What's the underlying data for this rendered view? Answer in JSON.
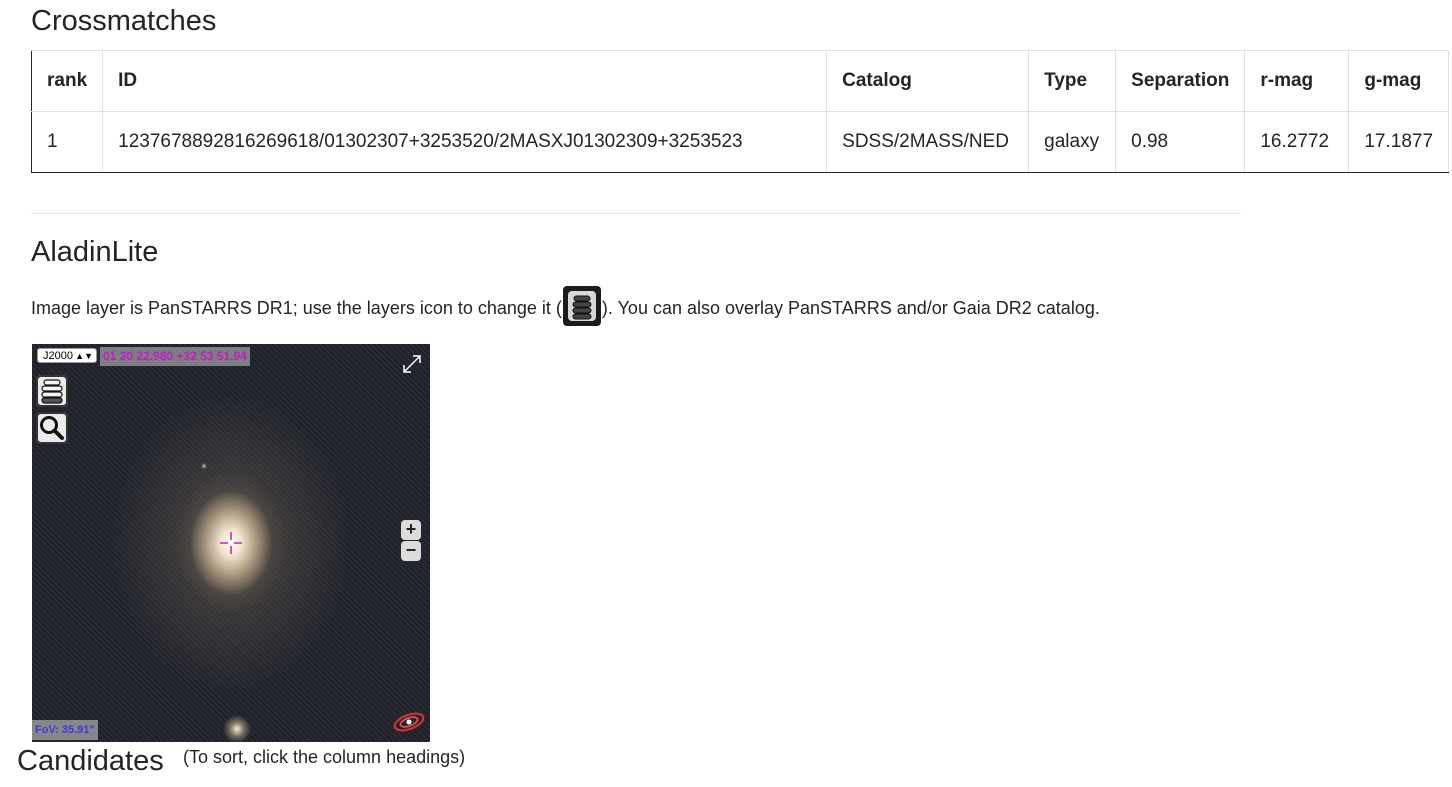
{
  "crossmatches": {
    "title": "Crossmatches",
    "columns": [
      "rank",
      "ID",
      "Catalog",
      "Type",
      "Separation",
      "r-mag",
      "g-mag"
    ],
    "rows": [
      [
        "1",
        "1237678892816269618/01302307+3253520/2MASXJ01302309+3253523",
        "SDSS/2MASS/NED",
        "galaxy",
        "0.98",
        "16.2772",
        "17.1877"
      ]
    ]
  },
  "aladin": {
    "title": "AladinLite",
    "desc_before": "Image layer is PanSTARRS DR1; use the layers icon to change it  (",
    "desc_after": "). You can also overlay PanSTARRS and/or Gaia DR2 catalog.",
    "frame": "J2000",
    "coords": "01 30 22.980 +32 53 51.94",
    "zoom_in": "+",
    "zoom_out": "−",
    "fov": "FoV: 35.91\"",
    "icons": [
      "layers-icon",
      "search-icon",
      "fullscreen-icon",
      "aladin-logo-icon",
      "reticle-icon"
    ],
    "colors": {
      "coord_text": "#c020c0",
      "fov_text": "#3b3bd6",
      "reticle": "#c030c0"
    }
  },
  "candidates": {
    "title": "Candidates",
    "note": "(To sort, click the column headings)"
  }
}
